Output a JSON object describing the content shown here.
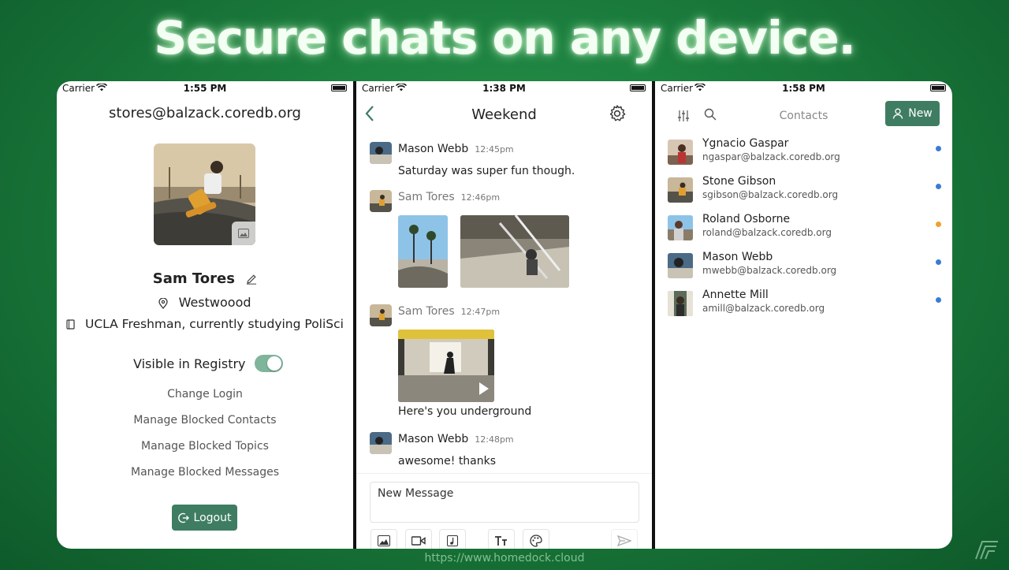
{
  "headline": "Secure chats on any device.",
  "footer_url": "https://www.homedock.cloud",
  "colors": {
    "accent": "#3f7d63",
    "toggle_on": "#7fb59a",
    "status_blue": "#3a7bd5",
    "status_orange": "#f0a030"
  },
  "profile_screen": {
    "status": {
      "carrier": "Carrier",
      "time": "1:55 PM"
    },
    "email": "stores@balzack.coredb.org",
    "name": "Sam Tores",
    "location": "Westwoood",
    "bio": "UCLA Freshman, currently studying PoliSci",
    "registry_label": "Visible in Registry",
    "registry_on": true,
    "links": [
      "Change Login",
      "Manage Blocked Contacts",
      "Manage Blocked Topics",
      "Manage Blocked Messages"
    ],
    "logout_label": "Logout"
  },
  "chat_screen": {
    "status": {
      "carrier": "Carrier",
      "time": "1:38 PM"
    },
    "title": "Weekend",
    "messages": [
      {
        "sender": "Mason Webb",
        "time": "12:45pm",
        "text": "Saturday was super fun though."
      },
      {
        "sender": "Sam Tores",
        "time": "12:46pm",
        "text": ""
      },
      {
        "sender": "Sam Tores",
        "time": "12:47pm",
        "text": "Here's you underground"
      },
      {
        "sender": "Mason Webb",
        "time": "12:48pm",
        "text": "awesome! thanks"
      }
    ],
    "composer_placeholder": "New Message",
    "composer_tools": [
      "image-icon",
      "video-icon",
      "audio-icon",
      "text-format-icon",
      "palette-icon",
      "send-icon"
    ]
  },
  "contacts_screen": {
    "status": {
      "carrier": "Carrier",
      "time": "1:58 PM"
    },
    "title": "Contacts",
    "new_label": "New",
    "contacts": [
      {
        "name": "Ygnacio Gaspar",
        "email": "ngaspar@balzack.coredb.org",
        "status_color": "#3a7bd5"
      },
      {
        "name": "Stone Gibson",
        "email": "sgibson@balzack.coredb.org",
        "status_color": "#3a7bd5"
      },
      {
        "name": "Roland Osborne",
        "email": "roland@balzack.coredb.org",
        "status_color": "#f0a030"
      },
      {
        "name": "Mason Webb",
        "email": "mwebb@balzack.coredb.org",
        "status_color": "#3a7bd5"
      },
      {
        "name": "Annette Mill",
        "email": "amill@balzack.coredb.org",
        "status_color": "#3a7bd5"
      }
    ]
  }
}
